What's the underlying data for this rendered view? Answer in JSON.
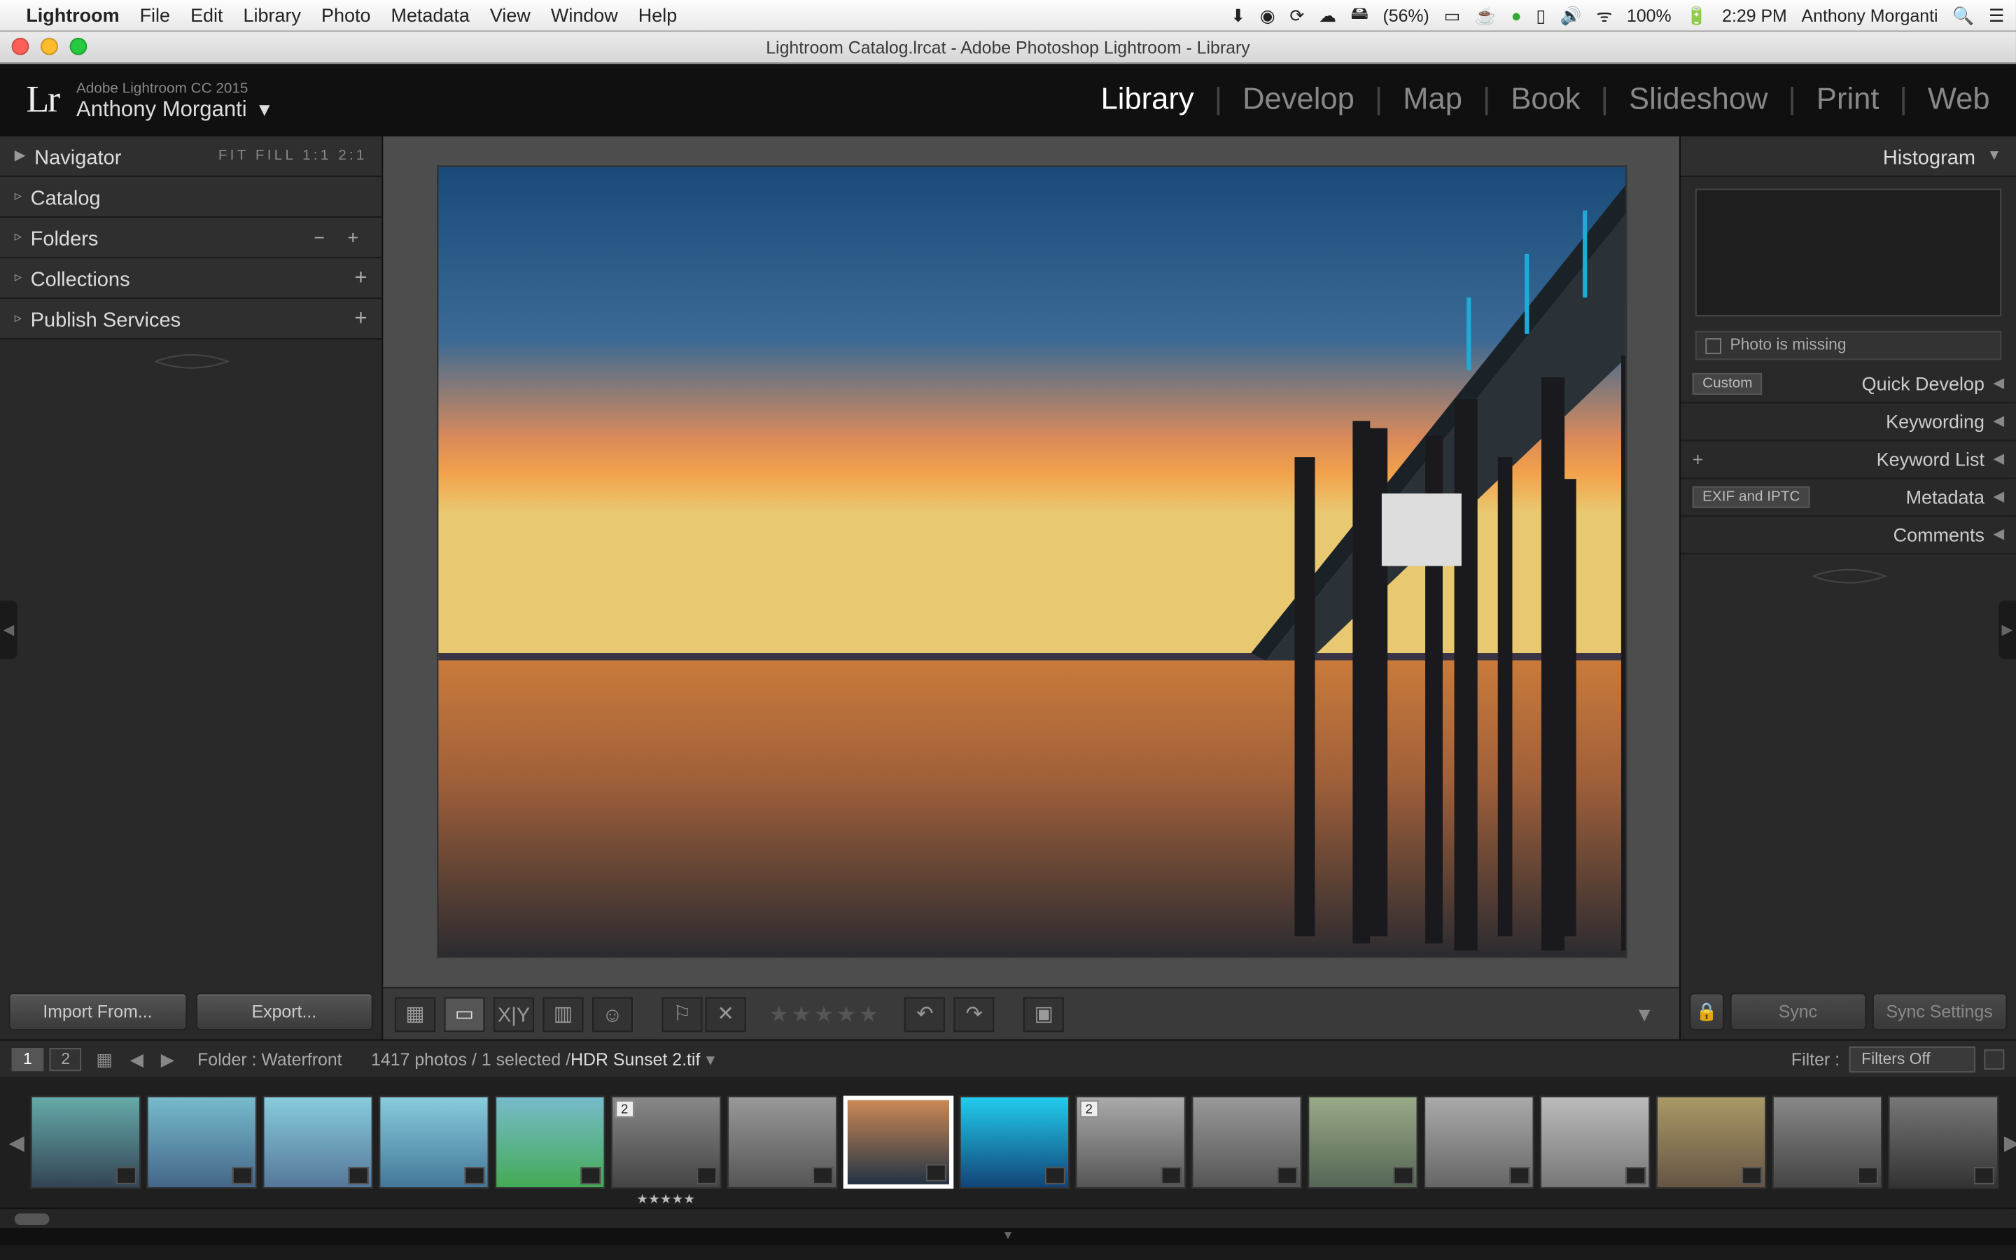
{
  "menubar": {
    "app": "Lightroom",
    "items": [
      "File",
      "Edit",
      "Library",
      "Photo",
      "Metadata",
      "View",
      "Window",
      "Help"
    ],
    "battery_pct": "(56%)",
    "wifi_pct": "100%",
    "time": "2:29 PM",
    "user": "Anthony Morganti"
  },
  "titlebar": "Lightroom Catalog.lrcat - Adobe Photoshop Lightroom - Library",
  "identity": {
    "product": "Adobe Lightroom CC 2015",
    "user": "Anthony Morganti",
    "logo": "Lr"
  },
  "modules": [
    "Library",
    "Develop",
    "Map",
    "Book",
    "Slideshow",
    "Print",
    "Web"
  ],
  "active_module": "Library",
  "left": {
    "navigator": {
      "label": "Navigator",
      "opts": "FIT  FILL  1:1  2:1"
    },
    "panels": [
      "Catalog",
      "Folders",
      "Collections",
      "Publish Services"
    ],
    "import_btn": "Import From...",
    "export_btn": "Export..."
  },
  "right": {
    "histogram": "Histogram",
    "warning": "Photo is missing",
    "quickdev": {
      "label": "Quick Develop",
      "preset": "Custom"
    },
    "keywording": "Keywording",
    "keywordlist": "Keyword List",
    "metadata": {
      "label": "Metadata",
      "preset": "EXIF and IPTC"
    },
    "comments": "Comments",
    "sync": "Sync",
    "syncset": "Sync Settings"
  },
  "filter": {
    "src1": "1",
    "src2": "2",
    "crumb_prefix": "Folder : ",
    "crumb_folder": "Waterfront",
    "count": "1417 photos",
    "sel": "1 selected",
    "file": "HDR Sunset 2.tif",
    "label": "Filter :",
    "value": "Filters Off"
  },
  "thumbs": {
    "count": 17,
    "selected_index": 7,
    "badge2_indices": [
      5,
      9
    ],
    "stars_index": 5
  }
}
